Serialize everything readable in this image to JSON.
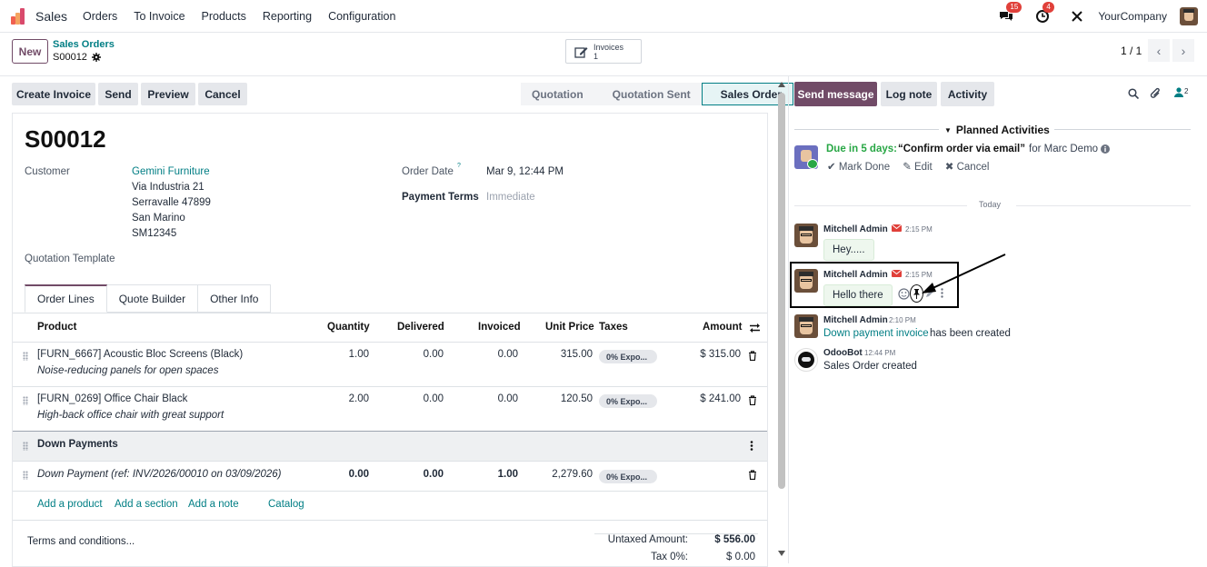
{
  "navbar": {
    "app_name": "Sales",
    "menu": [
      "Orders",
      "To Invoice",
      "Products",
      "Reporting",
      "Configuration"
    ],
    "messages_badge": "15",
    "activities_badge": "4",
    "company": "YourCompany"
  },
  "control": {
    "new_label": "New",
    "breadcrumb_parent": "Sales Orders",
    "breadcrumb_current": "S00012",
    "smart_invoices_label": "Invoices",
    "smart_invoices_count": "1",
    "pager": "1 / 1"
  },
  "actions": {
    "create_invoice": "Create Invoice",
    "send": "Send",
    "preview": "Preview",
    "cancel": "Cancel"
  },
  "statusbar": {
    "stages": [
      "Quotation",
      "Quotation Sent",
      "Sales Order"
    ],
    "active": "Sales Order"
  },
  "form": {
    "title": "S00012",
    "customer_label": "Customer",
    "customer_name": "Gemini Furniture",
    "customer_address": [
      "Via Industria 21",
      "Serravalle 47899",
      "San Marino",
      "SM12345"
    ],
    "order_date_label": "Order Date",
    "order_date_help": "?",
    "order_date": "Mar 9, 12:44 PM",
    "payment_terms_label": "Payment Terms",
    "payment_terms": "Immediate",
    "quotation_template_label": "Quotation Template",
    "tabs": [
      "Order Lines",
      "Quote Builder",
      "Other Info"
    ]
  },
  "lines": {
    "headers": {
      "product": "Product",
      "quantity": "Quantity",
      "delivered": "Delivered",
      "invoiced": "Invoiced",
      "unit_price": "Unit Price",
      "taxes": "Taxes",
      "amount": "Amount"
    },
    "rows": [
      {
        "product": "[FURN_6667] Acoustic Bloc Screens (Black)",
        "description": "Noise-reducing panels for open spaces",
        "quantity": "1.00",
        "delivered": "0.00",
        "invoiced": "0.00",
        "unit_price": "315.00",
        "tax": "0% Expo...",
        "amount": "$ 315.00"
      },
      {
        "product": "[FURN_0269] Office Chair Black",
        "description": "High-back office chair with great support",
        "quantity": "2.00",
        "delivered": "0.00",
        "invoiced": "0.00",
        "unit_price": "120.50",
        "tax": "0% Expo...",
        "amount": "$ 241.00"
      }
    ],
    "section": "Down Payments",
    "down_payment": {
      "description": "Down Payment (ref: INV/2026/00010 on 03/09/2026)",
      "quantity": "0.00",
      "delivered": "0.00",
      "invoiced": "1.00",
      "unit_price": "2,279.60",
      "tax": "0% Expo..."
    },
    "add_links": [
      "Add a product",
      "Add a section",
      "Add a note",
      "Catalog"
    ],
    "terms_placeholder": "Terms and conditions...",
    "untaxed_label": "Untaxed Amount:",
    "untaxed_value": "$ 556.00",
    "tax_label": "Tax 0%:",
    "tax_value": "$ 0.00"
  },
  "chatter": {
    "send_message": "Send message",
    "log_note": "Log note",
    "activity": "Activity",
    "followers_count": "2",
    "planned_label": "Planned Activities",
    "activity_due": "Due in 5 days:",
    "activity_summary": "“Confirm order via email”",
    "activity_for": "for Marc Demo",
    "mark_done": "Mark Done",
    "edit": "Edit",
    "cancel": "Cancel",
    "today_label": "Today",
    "messages": [
      {
        "author": "Mitchell Admin",
        "time": "2:15 PM",
        "body": "Hey....."
      },
      {
        "author": "Mitchell Admin",
        "time": "2:15 PM",
        "body": "Hello there"
      },
      {
        "author": "Mitchell Admin",
        "time": "2:10 PM",
        "link": "Down payment invoice",
        "body": "has been created"
      },
      {
        "author": "OdooBot",
        "time": "12:44 PM",
        "body": "Sales Order created"
      }
    ]
  },
  "colors": {
    "primary": "#714b67",
    "link": "#017e84",
    "success": "#28a745",
    "danger": "#e0403a"
  }
}
